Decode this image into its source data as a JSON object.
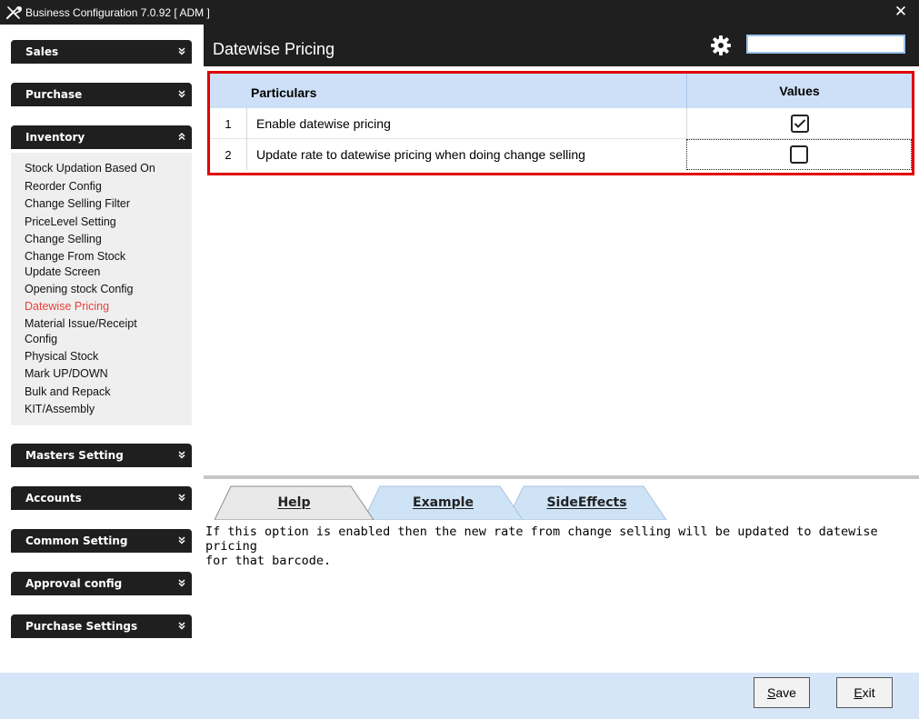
{
  "window": {
    "title": "Business Configuration 7.0.92 [ ADM ]",
    "close_glyph": "✕",
    "app_icon": "tools-icon"
  },
  "sidebar": {
    "categories": [
      {
        "label": "Sales",
        "chevron": "»",
        "expanded": false
      },
      {
        "label": "Purchase",
        "chevron": "»",
        "expanded": false
      },
      {
        "label": "Inventory",
        "chevron": "»",
        "expanded": true
      },
      {
        "label": "Masters Setting",
        "chevron": "»",
        "expanded": false
      },
      {
        "label": "Accounts",
        "chevron": "»",
        "expanded": false
      },
      {
        "label": "Common Setting",
        "chevron": "»",
        "expanded": false
      },
      {
        "label": "Approval config",
        "chevron": "»",
        "expanded": false
      },
      {
        "label": "Purchase Settings",
        "chevron": "»",
        "expanded": false
      }
    ],
    "inventory_items": [
      "Stock Updation Based On",
      "Reorder Config",
      "Change Selling Filter",
      "PriceLevel Setting",
      "Change Selling",
      "Change From Stock Update Screen",
      "Opening stock Config",
      "Datewise Pricing",
      "Material Issue/Receipt Config",
      "Physical Stock",
      "Mark UP/DOWN",
      "Bulk and Repack",
      "KIT/Assembly"
    ],
    "active_item": "Datewise Pricing",
    "active_color": "#e5413d"
  },
  "header": {
    "page_title": "Datewise Pricing",
    "settings_icon": "gear-icon",
    "search_value": ""
  },
  "grid": {
    "columns": [
      "Particulars",
      "Values"
    ],
    "rows": [
      {
        "num": "1",
        "particular": "Enable datewise pricing",
        "checked": true
      },
      {
        "num": "2",
        "particular": "Update rate to datewise pricing when doing change selling",
        "checked": false
      }
    ],
    "highlight_color": "#e00000",
    "header_color": "#cde0f7"
  },
  "tabs": {
    "items": [
      "Help",
      "Example",
      "SideEffects"
    ],
    "selected": "Help"
  },
  "help": {
    "line1": "If this option is enabled then the new rate from change selling will be updated to datewise pricing",
    "line2": "for that barcode."
  },
  "footer": {
    "save_label": "Save",
    "exit_label": "Exit"
  }
}
